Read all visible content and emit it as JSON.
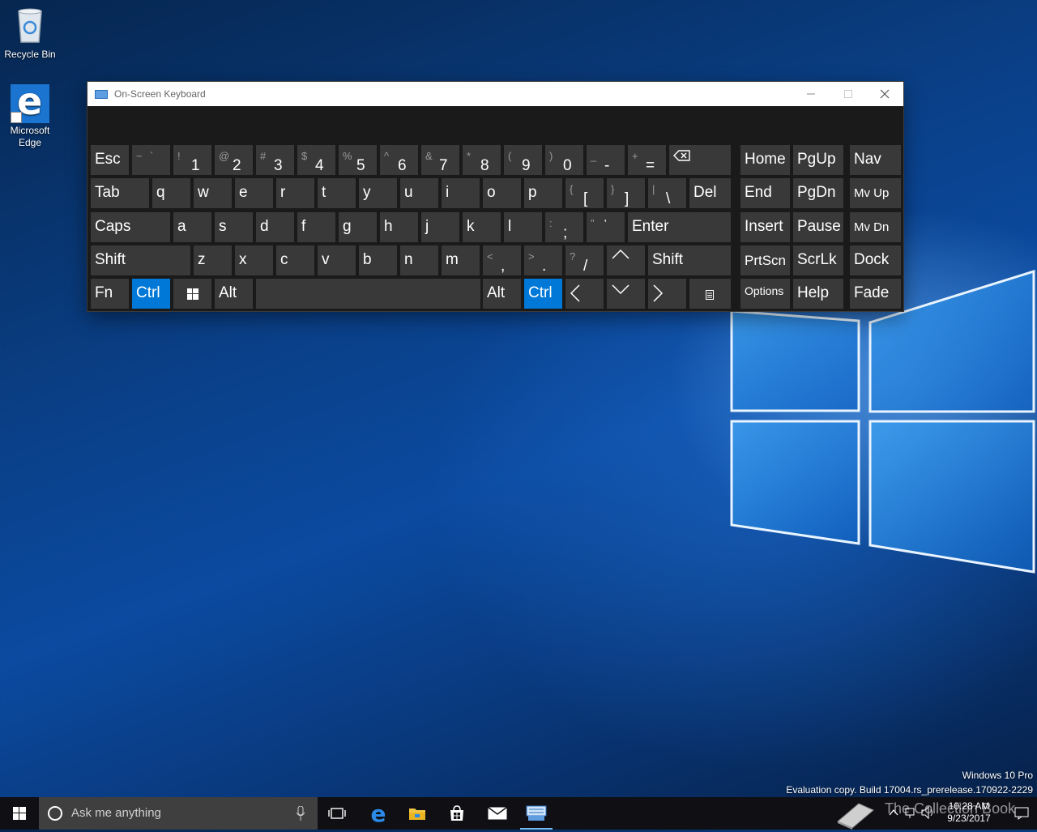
{
  "desktop": {
    "icons": [
      {
        "label": "Recycle Bin"
      },
      {
        "label_line1": "Microsoft",
        "label_line2": "Edge"
      }
    ],
    "watermark": {
      "line1": "Windows 10 Pro",
      "line2": "Evaluation copy. Build 17004.rs_prerelease.170922-2229"
    },
    "overlay_text": "The Collection Book"
  },
  "osk": {
    "title": "On-Screen Keyboard",
    "keys": {
      "esc": "Esc",
      "tilde_shift": "~",
      "tilde": "`",
      "n1_shift": "!",
      "n1": "1",
      "n2_shift": "@",
      "n2": "2",
      "n3_shift": "#",
      "n3": "3",
      "n4_shift": "$",
      "n4": "4",
      "n5_shift": "%",
      "n5": "5",
      "n6_shift": "^",
      "n6": "6",
      "n7_shift": "&",
      "n7": "7",
      "n8_shift": "*",
      "n8": "8",
      "n9_shift": "(",
      "n9": "9",
      "n0_shift": ")",
      "n0": "0",
      "minus_shift": "_",
      "minus": "-",
      "equal_shift": "+",
      "equal": "=",
      "home": "Home",
      "pgup": "PgUp",
      "nav": "Nav",
      "tab": "Tab",
      "q": "q",
      "w": "w",
      "e": "e",
      "r": "r",
      "t": "t",
      "y": "y",
      "u": "u",
      "i": "i",
      "o": "o",
      "p": "p",
      "lbracket_shift": "{",
      "lbracket": "[",
      "rbracket_shift": "}",
      "rbracket": "]",
      "backslash_shift": "|",
      "backslash": "\\",
      "del": "Del",
      "end": "End",
      "pgdn": "PgDn",
      "mvup": "Mv Up",
      "caps": "Caps",
      "a": "a",
      "s": "s",
      "d": "d",
      "f": "f",
      "g": "g",
      "h": "h",
      "j": "j",
      "k": "k",
      "l": "l",
      "semicolon_shift": ":",
      "semicolon": ";",
      "quote_shift": "\"",
      "quote": "'",
      "enter": "Enter",
      "insert": "Insert",
      "pause": "Pause",
      "mvdn": "Mv Dn",
      "lshift": "Shift",
      "z": "z",
      "x": "x",
      "c": "c",
      "v": "v",
      "b": "b",
      "n": "n",
      "m": "m",
      "comma_shift": "<",
      "comma": ",",
      "period_shift": ">",
      "period": ".",
      "slash_shift": "?",
      "slash": "/",
      "rshift": "Shift",
      "prtscn": "PrtScn",
      "scrlk": "ScrLk",
      "dock": "Dock",
      "fn": "Fn",
      "lctrl": "Ctrl",
      "lalt": "Alt",
      "ralt": "Alt",
      "rctrl": "Ctrl",
      "options": "Options",
      "help": "Help",
      "fade": "Fade"
    },
    "selected_keys": [
      "lctrl",
      "rctrl"
    ]
  },
  "taskbar": {
    "search_placeholder": "Ask me anything",
    "clock_time": "10:28 AM",
    "clock_date": "9/23/2017",
    "apps": [
      "task-view",
      "edge",
      "file-explorer",
      "store",
      "mail",
      "on-screen-keyboard"
    ],
    "active_app": "on-screen-keyboard"
  },
  "colors": {
    "accent": "#0078d7",
    "key_bg": "#393939",
    "osk_bg": "#1a1a1a",
    "taskbar_bg": "#0f0f14"
  }
}
